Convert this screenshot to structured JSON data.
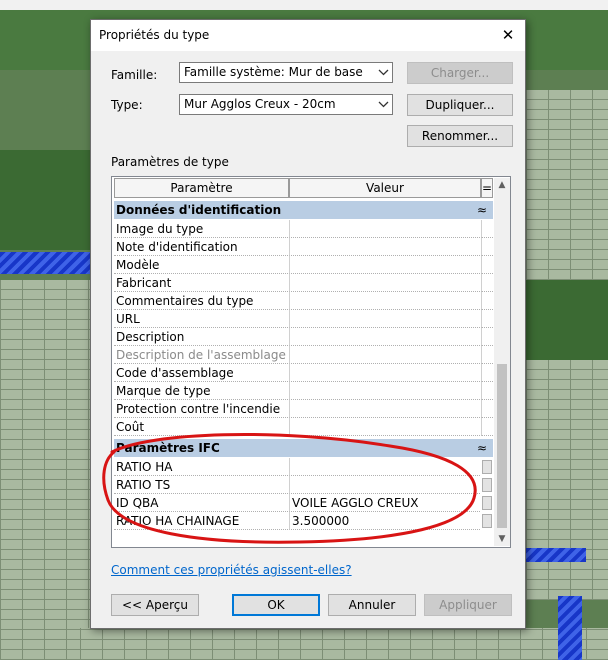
{
  "dialog": {
    "title": "Propriétés du type",
    "close_glyph": "✕",
    "famille_label": "Famille:",
    "famille_value": "Famille système: Mur de base",
    "type_label": "Type:",
    "type_value": "Mur Agglos Creux - 20cm",
    "charger_label": "Charger...",
    "dupliquer_label": "Dupliquer...",
    "renommer_label": "Renommer...",
    "section_label": "Paramètres de type",
    "help_link": "Comment ces propriétés agissent-elles?",
    "apercu_label": "<< Aperçu",
    "ok_label": "OK",
    "annuler_label": "Annuler",
    "appliquer_label": "Appliquer"
  },
  "grid": {
    "col_param": "Paramètre",
    "col_value": "Valeur",
    "col_eq": "=",
    "collapse_glyph": "≈",
    "group1": {
      "title": "Données d'identification",
      "rows": [
        {
          "name": "Image du type",
          "value": ""
        },
        {
          "name": "Note d'identification",
          "value": ""
        },
        {
          "name": "Modèle",
          "value": ""
        },
        {
          "name": "Fabricant",
          "value": ""
        },
        {
          "name": "Commentaires du type",
          "value": ""
        },
        {
          "name": "URL",
          "value": ""
        },
        {
          "name": "Description",
          "value": ""
        },
        {
          "name": "Description de l'assemblage",
          "value": "",
          "disabled": true
        },
        {
          "name": "Code d'assemblage",
          "value": ""
        },
        {
          "name": "Marque de type",
          "value": ""
        },
        {
          "name": "Protection contre l'incendie",
          "value": ""
        },
        {
          "name": "Coût",
          "value": ""
        }
      ]
    },
    "group2": {
      "title": "Paramètres IFC",
      "rows": [
        {
          "name": "RATIO HA",
          "value": ""
        },
        {
          "name": "RATIO TS",
          "value": ""
        },
        {
          "name": "ID QBA",
          "value": "VOILE AGGLO CREUX"
        },
        {
          "name": "RATIO HA CHAINAGE",
          "value": "3.500000"
        }
      ]
    }
  },
  "colors": {
    "group_header": "#b9cde3",
    "link": "#0066cc",
    "annotation_red": "#d81414",
    "default_button_border": "#0078d7"
  }
}
